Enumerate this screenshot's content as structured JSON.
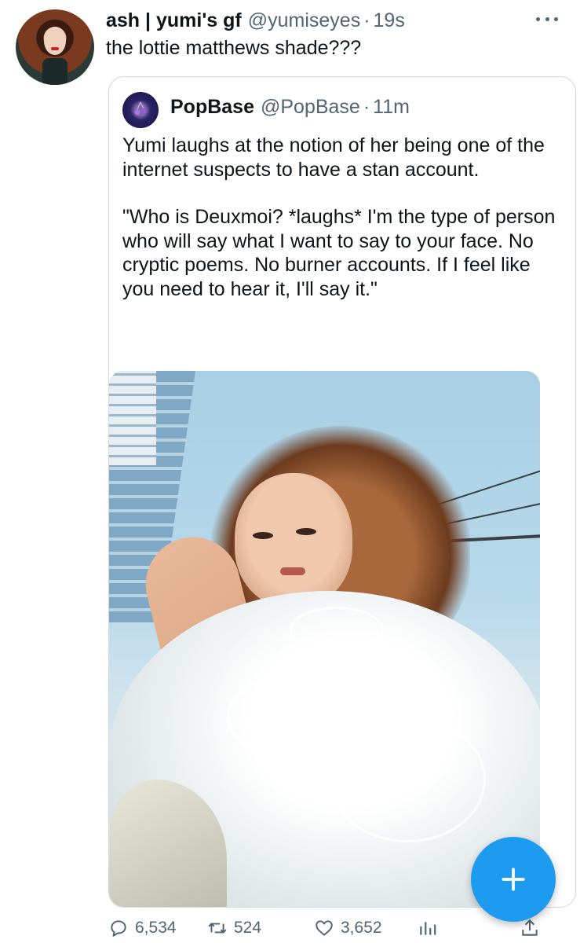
{
  "tweet": {
    "author_name": "ash | yumi's gf",
    "author_handle": "@yumiseyes",
    "separator": "·",
    "time": "19s",
    "text": "the lottie matthews shade???"
  },
  "quote": {
    "author_name": "PopBase",
    "author_handle": "@PopBase",
    "separator": "·",
    "time": "11m",
    "paragraph_1": "Yumi laughs at the notion of her being one of the internet suspects to have a stan account.",
    "paragraph_2": "\"Who is Deuxmoi? *laughs* I'm the type of person who will say what I want to say to your face. No cryptic poems. No burner accounts. If I feel like you need to hear it, I'll say it.\""
  },
  "actions": {
    "reply_count": "6,534",
    "retweet_count": "524",
    "like_count": "3,652"
  },
  "icons": {
    "more": "more-icon",
    "reply": "reply-icon",
    "retweet": "retweet-icon",
    "like": "heart-icon",
    "analytics": "analytics-icon",
    "share": "share-icon",
    "compose": "plus-icon"
  },
  "colors": {
    "accent": "#1d9bf0",
    "muted": "#536471",
    "text": "#0f1419",
    "border": "#cfd9de"
  }
}
